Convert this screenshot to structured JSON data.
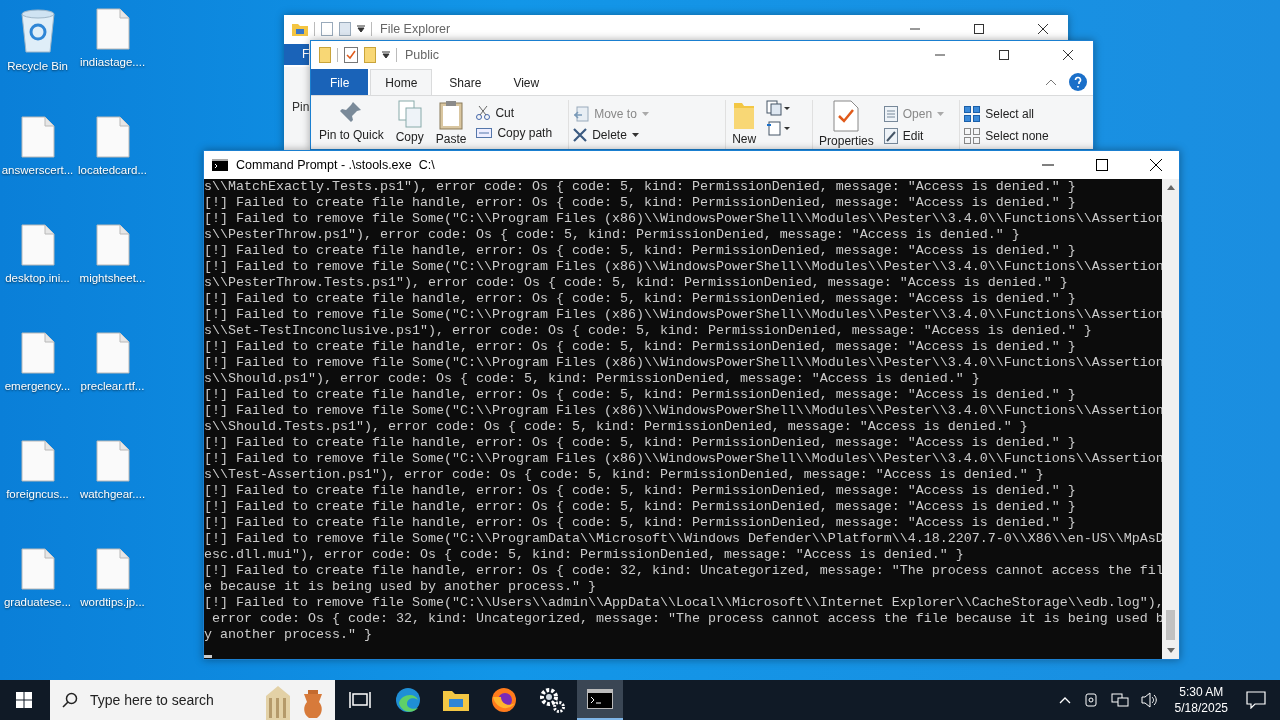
{
  "desktop_icons": [
    {
      "label": "Recycle Bin",
      "kind": "bin"
    },
    {
      "label": "indiastage....",
      "kind": "file"
    },
    {
      "label": "answerscert...",
      "kind": "file"
    },
    {
      "label": "locatedcard...",
      "kind": "file"
    },
    {
      "label": "desktop.ini...",
      "kind": "file"
    },
    {
      "label": "mightsheet...",
      "kind": "file"
    },
    {
      "label": "emergency...",
      "kind": "file"
    },
    {
      "label": "preclear.rtf...",
      "kind": "file"
    },
    {
      "label": "foreigncus...",
      "kind": "file"
    },
    {
      "label": "watchgear....",
      "kind": "file"
    },
    {
      "label": "graduatese...",
      "kind": "file"
    },
    {
      "label": "wordtips.jp...",
      "kind": "file"
    }
  ],
  "explorer_back": {
    "title": "File Explorer",
    "tab_partial": "F",
    "ribbon_partial": "Pin"
  },
  "explorer_front": {
    "title": "Public",
    "tabs": [
      {
        "label": "File",
        "kind": "file",
        "selected": false
      },
      {
        "label": "Home",
        "kind": "tab",
        "selected": true
      },
      {
        "label": "Share",
        "kind": "tab",
        "selected": false
      },
      {
        "label": "View",
        "kind": "tab",
        "selected": false
      }
    ],
    "clipboard_large": [
      "Pin to Quick",
      "Copy",
      "Paste"
    ],
    "clipboard_small": [
      "Cut",
      "Copy path"
    ],
    "organize": [
      "Move to",
      "Delete"
    ],
    "new_label": "New",
    "properties_label": "Properties",
    "open_small": [
      "Open",
      "Edit"
    ],
    "select": [
      "Select all",
      "Select none"
    ]
  },
  "console": {
    "title": "Command Prompt - .\\stools.exe  C:\\",
    "lines": [
      "s\\\\MatchExactly.Tests.ps1\"), error code: Os { code: 5, kind: PermissionDenied, message: \"Access is denied.\" }",
      "[!] Failed to create file handle, error: Os { code: 5, kind: PermissionDenied, message: \"Access is denied.\" }",
      "[!] Failed to remove file Some(\"C:\\\\Program Files (x86)\\\\WindowsPowerShell\\\\Modules\\\\Pester\\\\3.4.0\\\\Functions\\\\Assertion",
      "s\\\\PesterThrow.ps1\"), error code: Os { code: 5, kind: PermissionDenied, message: \"Access is denied.\" }",
      "[!] Failed to create file handle, error: Os { code: 5, kind: PermissionDenied, message: \"Access is denied.\" }",
      "[!] Failed to remove file Some(\"C:\\\\Program Files (x86)\\\\WindowsPowerShell\\\\Modules\\\\Pester\\\\3.4.0\\\\Functions\\\\Assertion",
      "s\\\\PesterThrow.Tests.ps1\"), error code: Os { code: 5, kind: PermissionDenied, message: \"Access is denied.\" }",
      "[!] Failed to create file handle, error: Os { code: 5, kind: PermissionDenied, message: \"Access is denied.\" }",
      "[!] Failed to remove file Some(\"C:\\\\Program Files (x86)\\\\WindowsPowerShell\\\\Modules\\\\Pester\\\\3.4.0\\\\Functions\\\\Assertion",
      "s\\\\Set-TestInconclusive.ps1\"), error code: Os { code: 5, kind: PermissionDenied, message: \"Access is denied.\" }",
      "[!] Failed to create file handle, error: Os { code: 5, kind: PermissionDenied, message: \"Access is denied.\" }",
      "[!] Failed to remove file Some(\"C:\\\\Program Files (x86)\\\\WindowsPowerShell\\\\Modules\\\\Pester\\\\3.4.0\\\\Functions\\\\Assertion",
      "s\\\\Should.ps1\"), error code: Os { code: 5, kind: PermissionDenied, message: \"Access is denied.\" }",
      "[!] Failed to create file handle, error: Os { code: 5, kind: PermissionDenied, message: \"Access is denied.\" }",
      "[!] Failed to remove file Some(\"C:\\\\Program Files (x86)\\\\WindowsPowerShell\\\\Modules\\\\Pester\\\\3.4.0\\\\Functions\\\\Assertion",
      "s\\\\Should.Tests.ps1\"), error code: Os { code: 5, kind: PermissionDenied, message: \"Access is denied.\" }",
      "[!] Failed to create file handle, error: Os { code: 5, kind: PermissionDenied, message: \"Access is denied.\" }",
      "[!] Failed to remove file Some(\"C:\\\\Program Files (x86)\\\\WindowsPowerShell\\\\Modules\\\\Pester\\\\3.4.0\\\\Functions\\\\Assertion",
      "s\\\\Test-Assertion.ps1\"), error code: Os { code: 5, kind: PermissionDenied, message: \"Access is denied.\" }",
      "[!] Failed to create file handle, error: Os { code: 5, kind: PermissionDenied, message: \"Access is denied.\" }",
      "[!] Failed to create file handle, error: Os { code: 5, kind: PermissionDenied, message: \"Access is denied.\" }",
      "[!] Failed to create file handle, error: Os { code: 5, kind: PermissionDenied, message: \"Access is denied.\" }",
      "[!] Failed to remove file Some(\"C:\\\\ProgramData\\\\Microsoft\\\\Windows Defender\\\\Platform\\\\4.18.2207.7-0\\\\X86\\\\en-US\\\\MpAsD",
      "esc.dll.mui\"), error code: Os { code: 5, kind: PermissionDenied, message: \"Access is denied.\" }",
      "[!] Failed to create file handle, error: Os { code: 32, kind: Uncategorized, message: \"The process cannot access the fil",
      "e because it is being used by another process.\" }",
      "[!] Failed to remove file Some(\"C:\\\\Users\\\\admin\\\\AppData\\\\Local\\\\Microsoft\\\\Internet Explorer\\\\CacheStorage\\\\edb.log\"),",
      " error code: Os { code: 32, kind: Uncategorized, message: \"The process cannot access the file because it is being used b",
      "y another process.\" }"
    ]
  },
  "taskbar": {
    "search": {
      "placeholder": "Type here to search"
    },
    "apps": [
      {
        "kind": "taskview",
        "selected": false
      },
      {
        "kind": "edge",
        "selected": false
      },
      {
        "kind": "explorer",
        "selected": false
      },
      {
        "kind": "firefox",
        "selected": false
      },
      {
        "kind": "settings",
        "selected": false
      },
      {
        "kind": "cmd",
        "selected": true
      }
    ],
    "time": "5:30 AM",
    "date": "5/18/2025"
  }
}
